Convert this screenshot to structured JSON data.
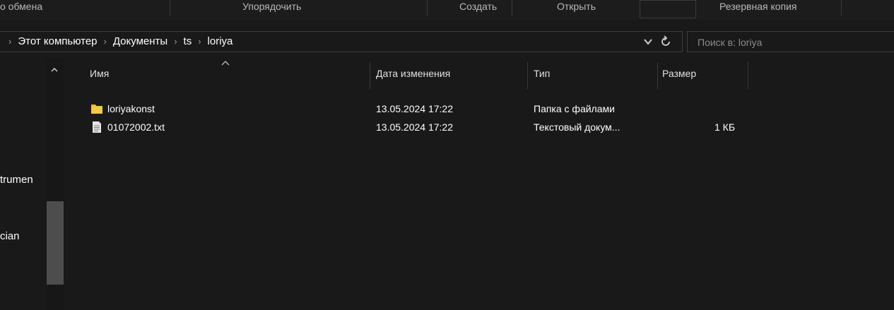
{
  "ribbon": {
    "groups": [
      {
        "label": "о обмена"
      },
      {
        "label": "Упорядочить"
      },
      {
        "label": "Создать"
      },
      {
        "label": "Открыть"
      },
      {
        "label": "Резервная копия"
      }
    ]
  },
  "address": {
    "crumbs": [
      "Этот компьютер",
      "Документы",
      "ts",
      "loriya"
    ]
  },
  "search": {
    "placeholder": "Поиск в: loriya"
  },
  "nav": {
    "items": [
      {
        "label": "trumen"
      },
      {
        "label": "cian"
      }
    ]
  },
  "columns": {
    "name": "Имя",
    "date": "Дата изменения",
    "type": "Тип",
    "size": "Размер"
  },
  "files": [
    {
      "name": "loriyakonst",
      "date": "13.05.2024 17:22",
      "type": "Папка с файлами",
      "size": "",
      "icon": "folder-icon"
    },
    {
      "name": "01072002.txt",
      "date": "13.05.2024 17:22",
      "type": "Текстовый докум...",
      "size": "1 КБ",
      "icon": "text-file-icon"
    }
  ],
  "colors": {
    "background": "#191919",
    "folder": "#f2c94c",
    "text": "#ffffff",
    "muted": "#b8b8b8"
  }
}
